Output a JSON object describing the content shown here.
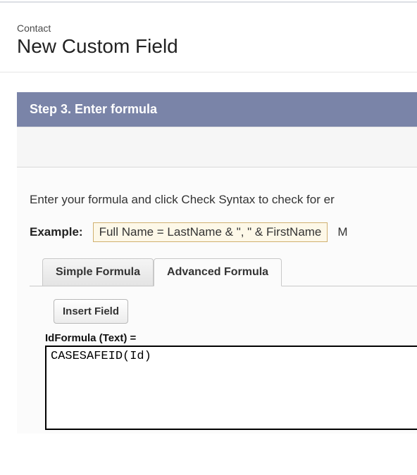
{
  "header": {
    "breadcrumb": "Contact",
    "page_title": "New Custom Field"
  },
  "wizard": {
    "step_title": "Step 3. Enter formula",
    "instruction": "Enter your formula and click Check Syntax to check for er",
    "example_label": "Example:",
    "example_value": "Full Name = LastName & \", \" & FirstName",
    "example_more": "M",
    "tabs": {
      "simple": "Simple Formula",
      "advanced": "Advanced Formula"
    },
    "insert_field_label": "Insert Field",
    "formula_label": "IdFormula (Text) =",
    "formula_value": "CASESAFEID(Id)"
  }
}
